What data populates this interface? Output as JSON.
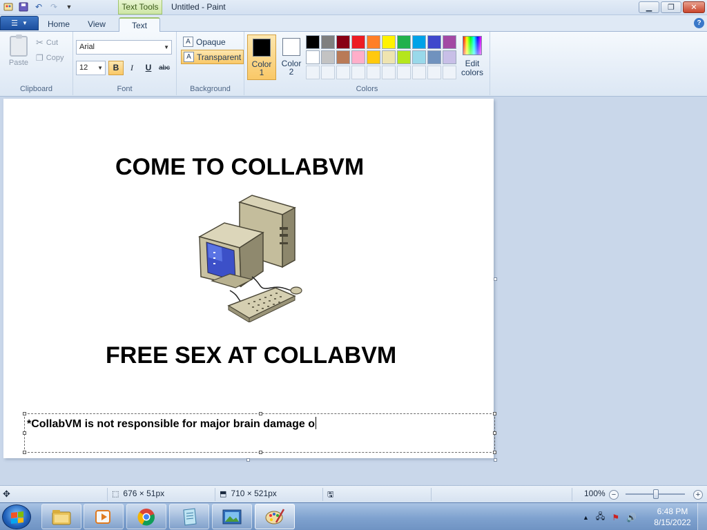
{
  "window": {
    "title": "Untitled - Paint",
    "context_tab": "Text Tools"
  },
  "tabs": [
    {
      "label": "Home"
    },
    {
      "label": "View"
    },
    {
      "label": "Text"
    }
  ],
  "clipboard": {
    "paste": "Paste",
    "cut": "Cut",
    "copy": "Copy",
    "label": "Clipboard"
  },
  "font": {
    "family": "Arial",
    "size": "12",
    "bold": "B",
    "italic": "I",
    "underline": "U",
    "strike": "abc",
    "label": "Font"
  },
  "background": {
    "opaque": "Opaque",
    "transparent": "Transparent",
    "label": "Background"
  },
  "colors": {
    "color1_line1": "Color",
    "color1_line2": "1",
    "color2_line1": "Color",
    "color2_line2": "2",
    "color1_value": "#000000",
    "color2_value": "#ffffff",
    "label": "Colors",
    "edit_line1": "Edit",
    "edit_line2": "colors",
    "palette": [
      "#000000",
      "#7f7f7f",
      "#880015",
      "#ed1c24",
      "#ff7f27",
      "#fff200",
      "#22b14c",
      "#00a2e8",
      "#3f48cc",
      "#a349a4",
      "#ffffff",
      "#c3c3c3",
      "#b97a57",
      "#ffaec9",
      "#ffc90e",
      "#efe4b0",
      "#b5e61d",
      "#99d9ea",
      "#7092be",
      "#c8bfe7"
    ]
  },
  "canvas": {
    "headline1": "COME TO COLLABVM",
    "headline2": "FREE SEX AT COLLABVM",
    "textbox": "*CollabVM is not responsible for major brain damage o"
  },
  "status": {
    "selection_size": "676 × 51px",
    "canvas_size": "710 × 521px",
    "zoom": "100%",
    "zoom_level": 1.0
  },
  "taskbar": {
    "time": "6:48 PM",
    "date": "8/15/2022"
  }
}
